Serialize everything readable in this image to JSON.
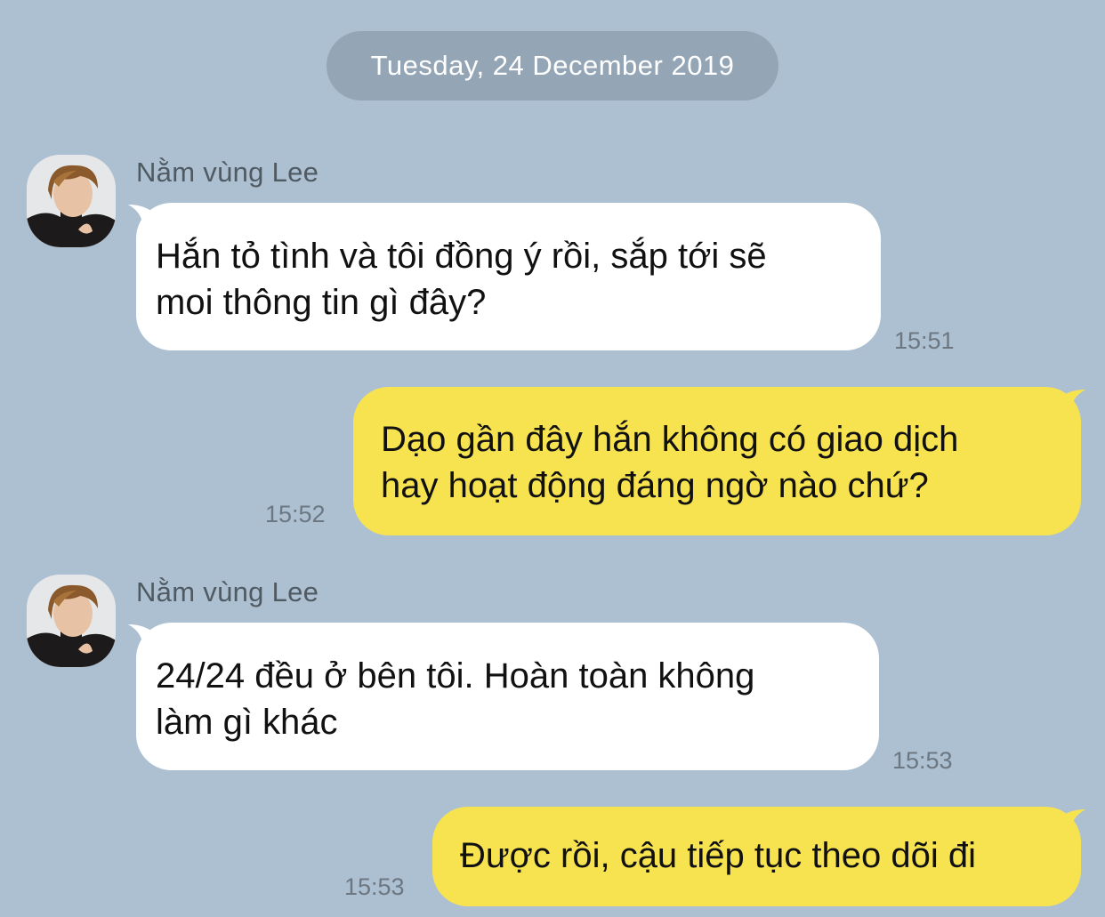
{
  "chat": {
    "date": "Tuesday, 24 December 2019",
    "messages": [
      {
        "sender": "Nằm vùng Lee",
        "lines": [
          "Hắn tỏ tình và tôi đồng ý rồi, sắp tới sẽ",
          "moi thông tin gì đây?"
        ],
        "time": "15:51"
      },
      {
        "lines": [
          "Dạo gần đây hắn không có giao dịch",
          "hay hoạt động đáng ngờ nào chứ?"
        ],
        "time": "15:52"
      },
      {
        "sender": "Nằm vùng Lee",
        "lines": [
          "24/24 đều ở bên tôi. Hoàn toàn không",
          "làm gì khác"
        ],
        "time": "15:53"
      },
      {
        "lines": [
          "Được rồi, cậu tiếp tục theo dõi đi"
        ],
        "time": "15:53"
      }
    ]
  },
  "colors": {
    "background": "#adc0d1",
    "incoming_bubble": "#ffffff",
    "outgoing_bubble": "#f7e34f",
    "date_pill": "#94a6b6"
  },
  "icons": {
    "avatar": "profile-photo"
  }
}
